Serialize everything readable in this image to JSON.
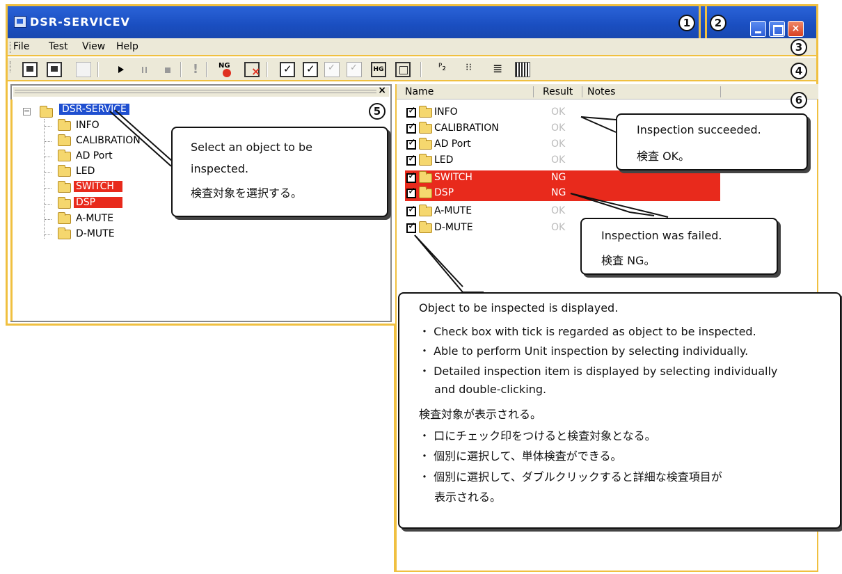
{
  "window": {
    "title": "DSR-SERVICEV",
    "buttons": {
      "min": "",
      "max": "",
      "close": "×"
    }
  },
  "markers": [
    "1",
    "2",
    "3",
    "4",
    "5",
    "6"
  ],
  "menu": [
    "File",
    "Test",
    "View",
    "Help"
  ],
  "toolbar_icons": [
    "new-test-icon",
    "open-test-icon",
    "save-icon",
    "play-icon",
    "pause-icon",
    "stop-icon",
    "exclamation-icon",
    "ng-icon",
    "clear-icon",
    "check-all-icon",
    "check-some-icon",
    "check-disabled-icon",
    "check-disabled-2-icon",
    "hg-icon",
    "window-icon",
    "large-icons-icon",
    "small-icons-icon",
    "list-icon",
    "details-icon"
  ],
  "left_pane": {
    "close": "×",
    "root": "DSR-SERVICE",
    "items": [
      "INFO",
      "CALIBRATION",
      "AD Port",
      "LED",
      "SWITCH",
      "DSP",
      "A-MUTE",
      "D-MUTE"
    ]
  },
  "right_pane": {
    "columns": [
      "Name",
      "Result",
      "Notes"
    ],
    "rows": [
      {
        "name": "INFO",
        "result": "OK"
      },
      {
        "name": "CALIBRATION",
        "result": "OK"
      },
      {
        "name": "AD Port",
        "result": "OK"
      },
      {
        "name": "LED",
        "result": "OK"
      },
      {
        "name": "SWITCH",
        "result": "NG"
      },
      {
        "name": "DSP",
        "result": "NG"
      },
      {
        "name": "A-MUTE",
        "result": "OK"
      },
      {
        "name": "D-MUTE",
        "result": "OK"
      }
    ]
  },
  "callouts": {
    "select": [
      "Select an object to be",
      "inspected.",
      "検査対象を選択する。"
    ],
    "ok": [
      "Inspection succeeded.",
      "検査 OK。"
    ],
    "ng": [
      "Inspection was failed.",
      "検査 NG。"
    ],
    "object": [
      "Object to be inspected is displayed.",
      "・ Check box with tick is regarded as object to be inspected.",
      "・ Able to perform Unit inspection by selecting individually.",
      "・ Detailed inspection item is displayed by selecting individually",
      "and double-clicking.",
      "検査対象が表示される。",
      "・ 口にチェック印をつけると検査対象となる。",
      "・ 個別に選択して、単体検査ができる。",
      "・ 個別に選択して、ダブルクリックすると詳細な検査項目が",
      "表示される。"
    ]
  },
  "colors": {
    "title_bar": "#1a4ec0",
    "frame": "#f0c040",
    "ng_highlight": "#e82a1c",
    "selected": "#1f4fd0"
  }
}
